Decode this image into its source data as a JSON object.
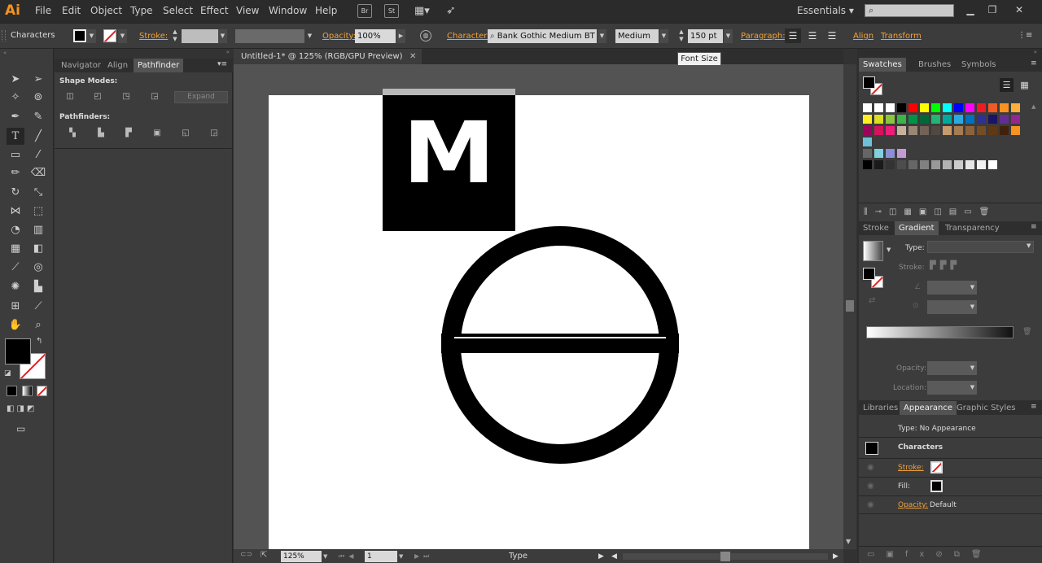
{
  "app": {
    "logo": "Ai",
    "workspace": "Essentials",
    "bridge_label": "Br",
    "stock_label": "St"
  },
  "menu": [
    "File",
    "Edit",
    "Object",
    "Type",
    "Select",
    "Effect",
    "View",
    "Window",
    "Help"
  ],
  "control_bar": {
    "selection_label": "Characters",
    "stroke_label": "Stroke:",
    "opacity_label": "Opacity:",
    "opacity_value": "100%",
    "character_label": "Character:",
    "font_family": "Bank Gothic Medium BT",
    "font_style": "Medium",
    "font_size": "150 pt",
    "paragraph_label": "Paragraph:",
    "align_label": "Align",
    "transform_label": "Transform",
    "tooltip": "Font Size"
  },
  "document": {
    "tab_title": "Untitled-1* @ 125% (RGB/GPU Preview)",
    "glyph": "M"
  },
  "pathfinder_panel": {
    "tabs": [
      "Navigator",
      "Align",
      "Pathfinder"
    ],
    "shape_modes_label": "Shape Modes:",
    "expand_label": "Expand",
    "pathfinders_label": "Pathfinders:"
  },
  "swatches_panel": {
    "tabs": [
      "Swatches",
      "Brushes",
      "Symbols"
    ]
  },
  "gradient_panel": {
    "tabs": [
      "Stroke",
      "Gradient",
      "Transparency"
    ],
    "type_label": "Type:",
    "stroke_label": "Stroke:",
    "opacity_label": "Opacity:",
    "location_label": "Location:"
  },
  "appearance_panel": {
    "tabs": [
      "Libraries",
      "Appearance",
      "Graphic Styles"
    ],
    "type_line": "Type: No Appearance",
    "object_label": "Characters",
    "stroke_label": "Stroke:",
    "fill_label": "Fill:",
    "opacity_label": "Opacity:",
    "opacity_value": "Default"
  },
  "status_bar": {
    "zoom": "125%",
    "artboard": "1",
    "tool": "Type"
  }
}
